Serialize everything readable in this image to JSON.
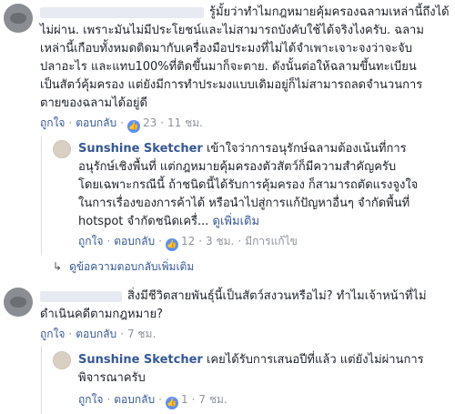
{
  "comment1": {
    "author_hidden": true,
    "lines": [
      "รู้มั้ยว่าทำไมกฎหมายคุ้มครองฉลามเหล่านี้ถึงได้",
      "ไม่ผ่าน. เพราะมันไม่มีประโยชน์และไม่สามารถบังคับใช้ได้จริงไงครับ. ฉลาม",
      "เหล่านี้เกือบทั้งหมดติดมากับเครื่องมือประมงที่ไม่ได้จำเพาะเจาะจงว่าจะจับ",
      "ปลาอะไร และแทบ100%ที่ติดขึ้นมาก็จะตาย. ดังนั้นต่อให้ฉลามขึ้นทะเบียน",
      "เป็นสัตว์คุ้มครอง แต่ยังมีการทำประมงแบบเดิมอยู่ก็ไม่สามารถลดจำนวนการ",
      "ตายของฉลามได้อยู่ดี"
    ],
    "like_label": "ถูกใจ",
    "reply_label": "ตอบกลับ",
    "like_count": "23",
    "time": "11 ชม."
  },
  "reply1": {
    "author": "Sunshine Sketcher",
    "text_first": "เข้าใจว่าการอนุรักษ์ฉลามต้องเน้นที่การ",
    "lines": [
      "อนุรักษ์เชิงพื้นที่ แต่กฎหมายคุ้มครองตัวสัตว์ก็มีความสำคัญครับ",
      "โดยเฉพาะกรณีนี้ ถ้าชนิดนี้ได้รับการคุ้มครอง ก็สามารถตัดแรงจูงใจ",
      "ในการเรื่องของการค้าได้ หรือนำไปสู่การแก้ปัญหาอื่นๆ จำกัดพื้นที่",
      "hotspot จำกัดชนิดเครื่..."
    ],
    "see_more": "ดูเพิ่มเติม",
    "like_label": "ถูกใจ",
    "reply_label": "ตอบกลับ",
    "like_count": "12",
    "time": "3 ชม.",
    "edited": "มีการแก้ไข"
  },
  "more_replies": "ดูข้อความตอบกลับเพิ่มเติม",
  "comment2": {
    "author_hidden": true,
    "lines": [
      "สิ่งมีชีวิตสายพันธุ์นี้เป็นสัตว์สงวนหรือไม่? ทำไมเจ้าหน้าที่ไม่",
      "ดำเนินคดีตามกฎหมาย?"
    ],
    "like_label": "ถูกใจ",
    "reply_label": "ตอบกลับ",
    "time": "7 ชม."
  },
  "reply2": {
    "author": "Sunshine Sketcher",
    "text_first": "เคยได้รับการเสนอปีที่แล้ว แต่ยังไม่ผ่านการ",
    "lines": [
      "พิจารณาครับ"
    ],
    "like_label": "ถูกใจ",
    "reply_label": "ตอบกลับ",
    "like_count": "1",
    "time": "7 ชม."
  },
  "colors": {
    "link": "#365899",
    "meta": "#90949c",
    "like_badge": "#5890ff"
  }
}
